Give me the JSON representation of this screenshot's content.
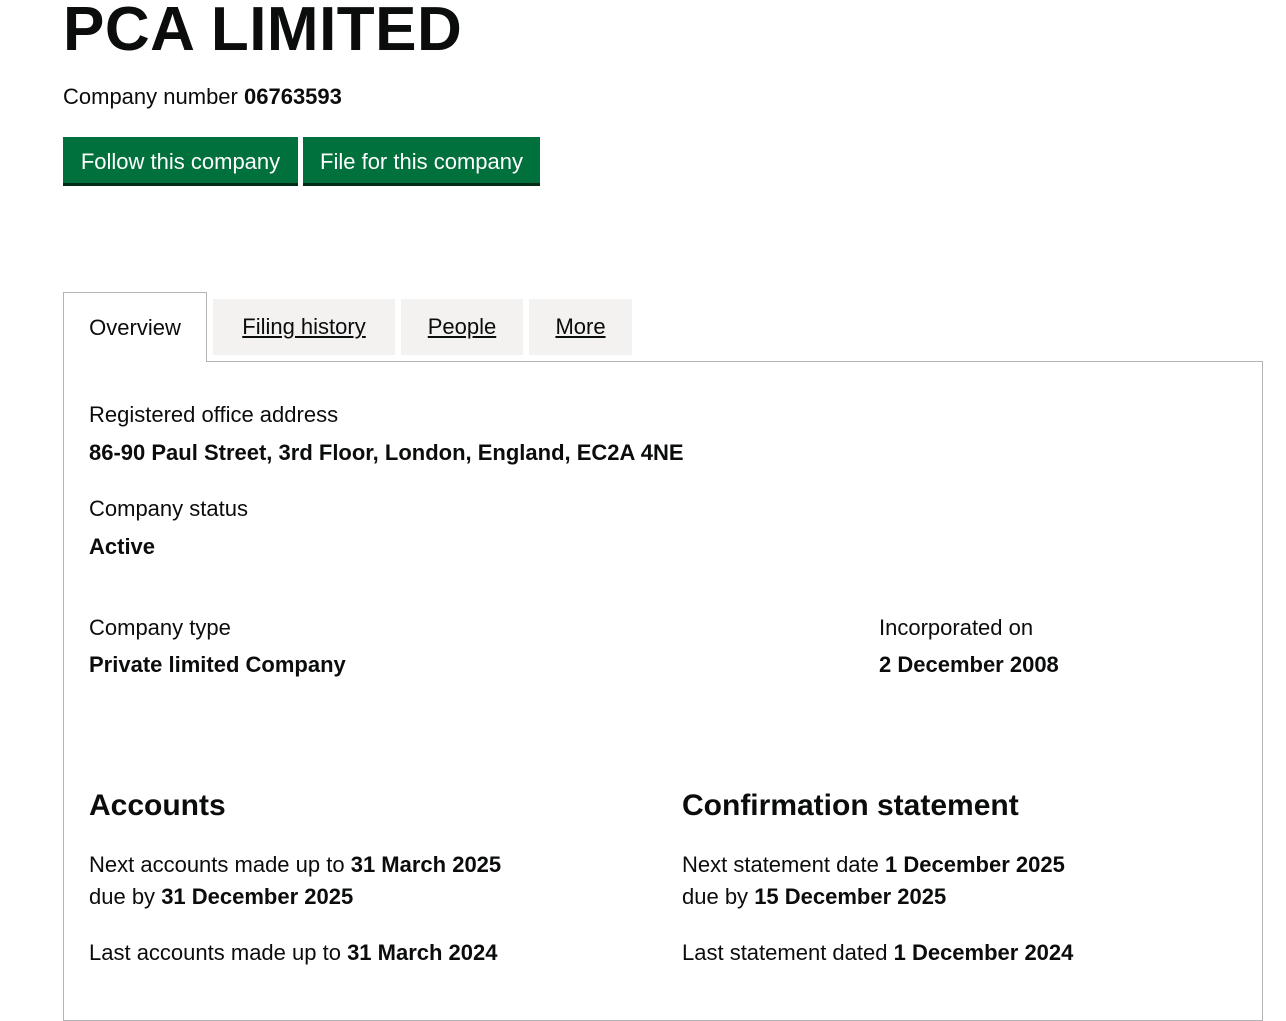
{
  "header": {
    "title": "PCA LIMITED",
    "company_number_label": "Company number",
    "company_number": "06763593"
  },
  "actions": {
    "follow": "Follow this company",
    "file": "File for this company"
  },
  "tabs": [
    {
      "label": "Overview",
      "active": true
    },
    {
      "label": "Filing history",
      "active": false
    },
    {
      "label": "People",
      "active": false
    },
    {
      "label": "More",
      "active": false
    }
  ],
  "overview": {
    "registered_office": {
      "label": "Registered office address",
      "value": "86-90 Paul Street, 3rd Floor, London, England, EC2A 4NE"
    },
    "status": {
      "label": "Company status",
      "value": "Active"
    },
    "type": {
      "label": "Company type",
      "value": "Private limited Company"
    },
    "incorporated": {
      "label": "Incorporated on",
      "value": "2 December 2008"
    }
  },
  "accounts": {
    "heading": "Accounts",
    "next_label": "Next accounts made up to",
    "next_value": "31 March 2025",
    "due_label": "due by",
    "due_value": "31 December 2025",
    "last_label": "Last accounts made up to",
    "last_value": "31 March 2024"
  },
  "confirmation": {
    "heading": "Confirmation statement",
    "next_label": "Next statement date",
    "next_value": "1 December 2025",
    "due_label": "due by",
    "due_value": "15 December 2025",
    "last_label": "Last statement dated",
    "last_value": "1 December 2024"
  },
  "colors": {
    "button": "#00703c",
    "tab_bg": "#f3f2f1",
    "border": "#b1b4b6",
    "text": "#0b0c0c"
  }
}
